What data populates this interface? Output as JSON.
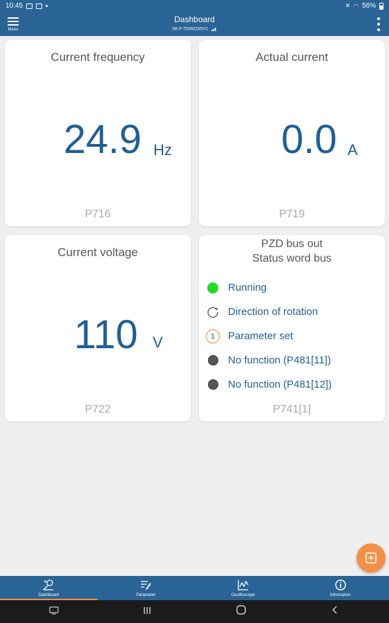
{
  "status_bar": {
    "time": "10:45",
    "battery": "56%"
  },
  "app_bar": {
    "menu_label": "Menu",
    "title": "Dashboard",
    "subtitle": "SK-P 750W/230V/1"
  },
  "cards": {
    "frequency": {
      "title": "Current frequency",
      "value": "24.9",
      "unit": "Hz",
      "param": "P716"
    },
    "current": {
      "title": "Actual current",
      "value": "0.0",
      "unit": "A",
      "param": "P719"
    },
    "voltage": {
      "title": "Current voltage",
      "value": "110",
      "unit": "V",
      "param": "P722"
    },
    "status": {
      "title_line1": "PZD bus out",
      "title_line2": "Status word bus",
      "param": "P741[1]",
      "items": [
        {
          "label": "Running",
          "icon": "green-dot-icon"
        },
        {
          "label": "Direction of rotation",
          "icon": "rotation-icon"
        },
        {
          "label": "Parameter set",
          "icon": "parameter-set-one-icon",
          "badge": "1"
        },
        {
          "label": "No function (P481[11])",
          "icon": "gray-dot-icon"
        },
        {
          "label": "No function (P481[12])",
          "icon": "gray-dot-icon"
        }
      ]
    }
  },
  "bottom_nav": [
    {
      "label": "Dashboard",
      "icon": "dashboard-icon",
      "active": true
    },
    {
      "label": "Parameter",
      "icon": "parameter-icon",
      "active": false
    },
    {
      "label": "Oscilloscope",
      "icon": "oscilloscope-icon",
      "active": false
    },
    {
      "label": "Information",
      "icon": "information-icon",
      "active": false
    }
  ],
  "colors": {
    "primary": "#2a6496",
    "accent": "#f39046",
    "value_text": "#1f5f96",
    "running": "#22dd22",
    "inactive": "#555555"
  }
}
